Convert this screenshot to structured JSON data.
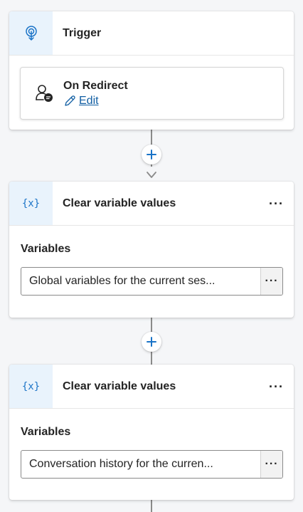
{
  "trigger": {
    "title": "Trigger",
    "event_name": "On Redirect",
    "edit_label": "Edit"
  },
  "nodes": [
    {
      "title": "Clear variable values",
      "icon_text": "{x}",
      "more_label": "···",
      "section_label": "Variables",
      "value": "Global variables for the current ses...",
      "value_more": "···"
    },
    {
      "title": "Clear variable values",
      "icon_text": "{x}",
      "more_label": "···",
      "section_label": "Variables",
      "value": "Conversation history for the curren...",
      "value_more": "···"
    }
  ],
  "colors": {
    "accent": "#1a73c7",
    "icon_bg": "#e9f3fc",
    "link": "#115ea3",
    "canvas": "#f5f6f8"
  }
}
